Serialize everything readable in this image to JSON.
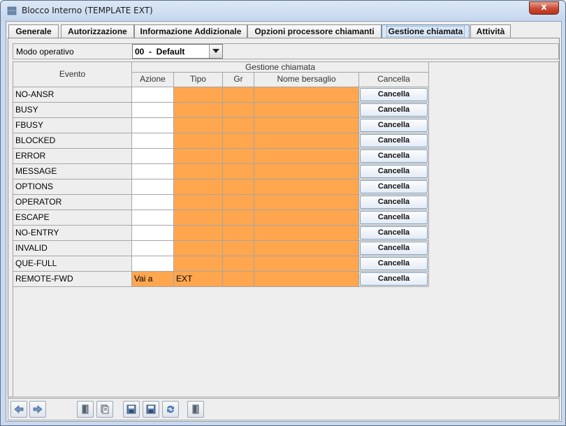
{
  "window": {
    "title": "Blocco Interno (TEMPLATE EXT)",
    "close_glyph": "x"
  },
  "tabs": [
    {
      "label": "Generale",
      "active": false
    },
    {
      "label": "Autorizzazione",
      "active": false
    },
    {
      "label": "Informazione Addizionale",
      "active": false
    },
    {
      "label": "Opzioni processore chiamanti",
      "active": false
    },
    {
      "label": "Gestione chiamata",
      "active": true
    },
    {
      "label": "Attività",
      "active": false
    }
  ],
  "mode": {
    "label": "Modo operativo",
    "value": "00  -  Default"
  },
  "table": {
    "group_header": "Gestione chiamata",
    "headers": {
      "evento": "Evento",
      "azione": "Azione",
      "tipo": "Tipo",
      "gr": "Gr",
      "nome": "Nome bersaglio",
      "cancella": "Cancella"
    },
    "rows": [
      {
        "evento": "NO-ANSR",
        "azione": "",
        "tipo": "",
        "gr": "",
        "nome": "",
        "button": "Cancella"
      },
      {
        "evento": "BUSY",
        "azione": "",
        "tipo": "",
        "gr": "",
        "nome": "",
        "button": "Cancella"
      },
      {
        "evento": "FBUSY",
        "azione": "",
        "tipo": "",
        "gr": "",
        "nome": "",
        "button": "Cancella"
      },
      {
        "evento": "BLOCKED",
        "azione": "",
        "tipo": "",
        "gr": "",
        "nome": "",
        "button": "Cancella"
      },
      {
        "evento": "ERROR",
        "azione": "",
        "tipo": "",
        "gr": "",
        "nome": "",
        "button": "Cancella"
      },
      {
        "evento": "MESSAGE",
        "azione": "",
        "tipo": "",
        "gr": "",
        "nome": "",
        "button": "Cancella"
      },
      {
        "evento": "OPTIONS",
        "azione": "",
        "tipo": "",
        "gr": "",
        "nome": "",
        "button": "Cancella"
      },
      {
        "evento": "OPERATOR",
        "azione": "",
        "tipo": "",
        "gr": "",
        "nome": "",
        "button": "Cancella"
      },
      {
        "evento": "ESCAPE",
        "azione": "",
        "tipo": "",
        "gr": "",
        "nome": "",
        "button": "Cancella"
      },
      {
        "evento": "NO-ENTRY",
        "azione": "",
        "tipo": "",
        "gr": "",
        "nome": "",
        "button": "Cancella"
      },
      {
        "evento": "INVALID",
        "azione": "",
        "tipo": "",
        "gr": "",
        "nome": "",
        "button": "Cancella"
      },
      {
        "evento": "QUE-FULL",
        "azione": "",
        "tipo": "",
        "gr": "",
        "nome": "",
        "button": "Cancella"
      },
      {
        "evento": "REMOTE-FWD",
        "azione": "Vai a",
        "tipo": "EXT",
        "gr": "",
        "nome": "",
        "button": "Cancella"
      }
    ]
  },
  "colors": {
    "orange_cell": "#ffa64f",
    "accent": "#6d8fbd"
  },
  "toolbar": {
    "buttons": [
      {
        "icon": "arrow-left-icon"
      },
      {
        "icon": "arrow-right-icon"
      },
      {
        "icon": "door-exit-icon"
      },
      {
        "icon": "copy-pages-icon"
      },
      {
        "icon": "save-icon"
      },
      {
        "icon": "save-as-icon"
      },
      {
        "icon": "refresh-icon"
      },
      {
        "icon": "exit-door-icon"
      }
    ]
  }
}
